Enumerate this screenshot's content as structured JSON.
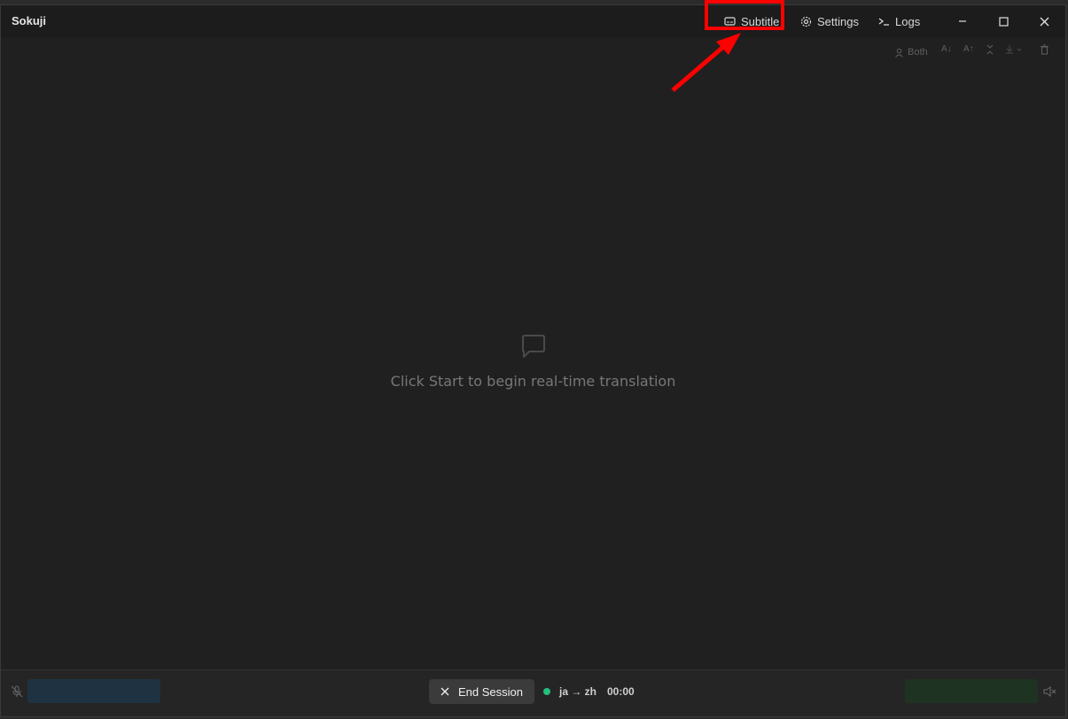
{
  "app": {
    "title": "Sokuji"
  },
  "titlebar": {
    "subtitle_label": "Subtitle",
    "settings_label": "Settings",
    "logs_label": "Logs"
  },
  "toolbar": {
    "speaker_filter_label": "Both"
  },
  "main": {
    "empty_message": "Click Start to begin real-time translation"
  },
  "footer": {
    "end_session_label": "End Session",
    "language_pair": "ja → zh",
    "timer": "00:00"
  },
  "colors": {
    "highlight": "#ff0000",
    "status_active": "#22c07a",
    "mic_meter": "#1e3242",
    "speaker_meter": "#1f3322"
  }
}
